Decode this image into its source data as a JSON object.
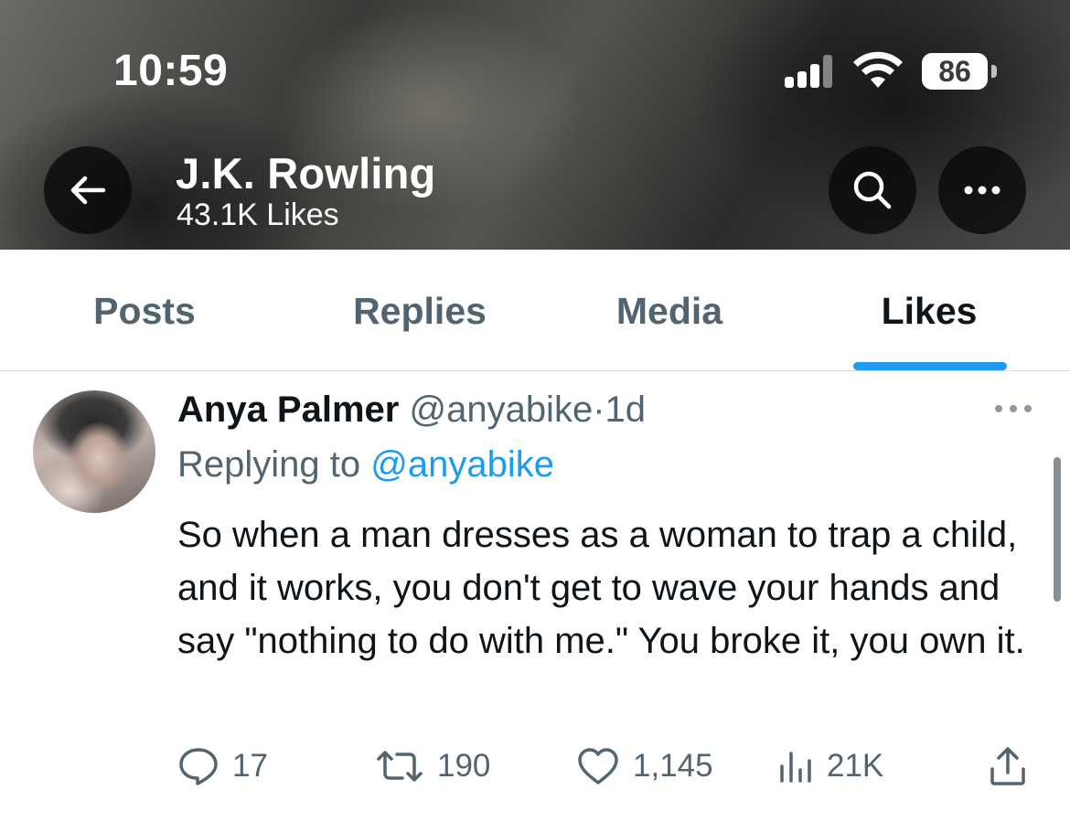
{
  "status_bar": {
    "time": "10:59",
    "battery": "86"
  },
  "header": {
    "name": "J.K. Rowling",
    "subtitle": "43.1K Likes"
  },
  "tabs": [
    {
      "label": "Posts",
      "active": false
    },
    {
      "label": "Replies",
      "active": false
    },
    {
      "label": "Media",
      "active": false
    },
    {
      "label": "Likes",
      "active": true
    }
  ],
  "tweet": {
    "author_name": "Anya Palmer",
    "author_handle": "@anyabike",
    "separator": "·",
    "time": "1d",
    "replying_prefix": "Replying to",
    "replying_handle": "@anyabike",
    "text": "So when a man dresses as a woman to trap a child, and it works, you don't get to wave your hands and say \"nothing to do with me.\" You broke it, you own it.",
    "actions": {
      "replies": "17",
      "reposts": "190",
      "likes": "1,145",
      "views": "21K"
    }
  },
  "colors": {
    "accent": "#1d9bf0",
    "muted": "#536471",
    "text": "#0f1419"
  }
}
